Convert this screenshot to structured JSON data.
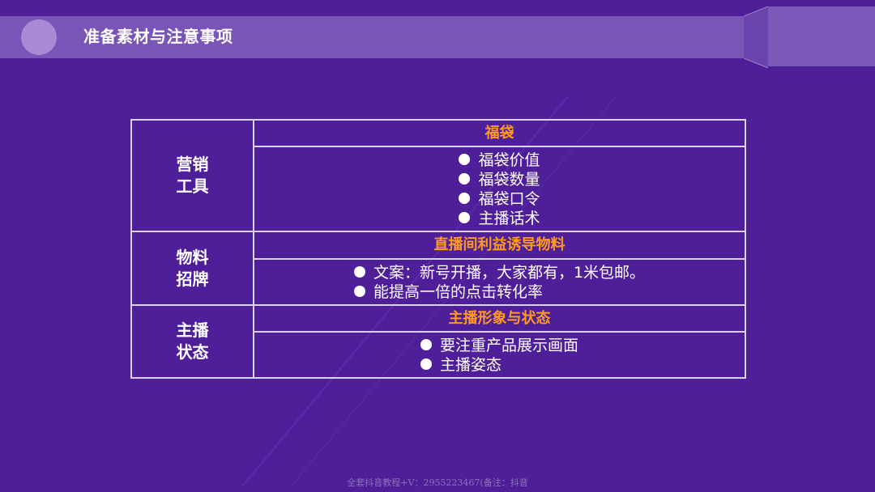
{
  "title": "准备素材与注意事项",
  "rows": [
    {
      "category": [
        "营销",
        "工具"
      ],
      "heading": "福袋",
      "items": [
        "福袋价值",
        "福袋数量",
        "福袋口令",
        "主播话术"
      ]
    },
    {
      "category": [
        "物料",
        "招牌"
      ],
      "heading": "直播间利益诱导物料",
      "items": [
        "文案：新号开播，大家都有，1米包邮。",
        "能提高一倍的点击转化率"
      ]
    },
    {
      "category": [
        "主播",
        "状态"
      ],
      "heading": "主播形象与状态",
      "items": [
        "要注重产品展示画面",
        "主播姿态"
      ]
    }
  ],
  "watermark": "全套抖音教程+V：2955223467(备注：抖音",
  "colors": {
    "background": "#4f1f9a",
    "title_band": "#7a55b8",
    "heading_text": "#ff9a1f",
    "table_border": "#d9d2ee"
  }
}
